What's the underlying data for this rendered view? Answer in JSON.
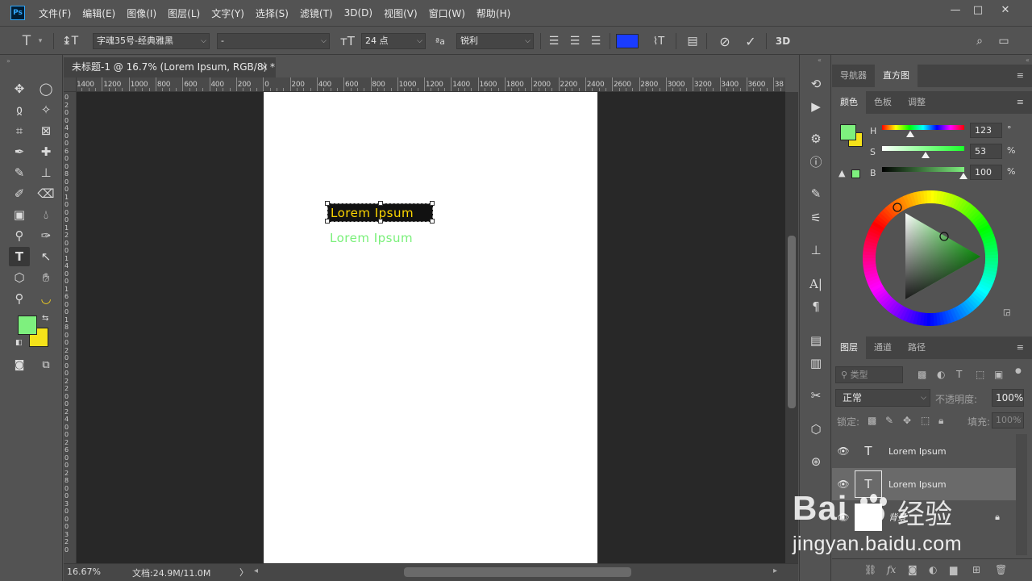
{
  "app": {
    "logo": "Ps"
  },
  "menu": [
    "文件(F)",
    "编辑(E)",
    "图像(I)",
    "图层(L)",
    "文字(Y)",
    "选择(S)",
    "滤镜(T)",
    "3D(D)",
    "视图(V)",
    "窗口(W)",
    "帮助(H)"
  ],
  "window_controls": {
    "minimize": "—",
    "restore": "□",
    "close": "✕"
  },
  "options": {
    "font_family": "字魂35号-经典雅黑",
    "font_style": "-",
    "font_size": "24 点",
    "aa_label": "ªa",
    "antialias": "锐利",
    "text_color": "#1a3cff",
    "threed_label": "3D"
  },
  "document": {
    "tab_title": "未标题-1 @ 16.7% (Lorem Ipsum, RGB/8) *",
    "close_glyph": "×",
    "ruler_h": [
      "1400",
      "1200",
      "1000",
      "800",
      "600",
      "400",
      "200",
      "0",
      "200",
      "400",
      "600",
      "800",
      "1000",
      "1200",
      "1400",
      "1600",
      "1800",
      "2000",
      "2200",
      "2400",
      "2600",
      "2800",
      "3000",
      "3200",
      "3400",
      "3600",
      "38"
    ],
    "ruler_v": [
      "0",
      "2",
      "0",
      "0",
      "4",
      "0",
      "0",
      "6",
      "0",
      "0",
      "8",
      "0",
      "0",
      "1",
      "0",
      "0",
      "0",
      "1",
      "2",
      "0",
      "0",
      "1",
      "4",
      "0",
      "0",
      "1",
      "6",
      "0",
      "0",
      "1",
      "8",
      "0",
      "0",
      "2",
      "0",
      "0",
      "0",
      "2",
      "2",
      "0",
      "0",
      "2",
      "4",
      "0",
      "0",
      "2",
      "6",
      "0",
      "0",
      "2",
      "8",
      "0",
      "0",
      "3",
      "0",
      "0",
      "0",
      "3",
      "2",
      "0"
    ]
  },
  "canvas": {
    "text_selected": "Lorem Ipsum",
    "text_green": "Lorem Ipsum",
    "text_selected_color": "#ffd700",
    "text_green_color": "#7af07a"
  },
  "status": {
    "zoom": "16.67%",
    "doc_info": "文档:24.9M/11.0M",
    "arrow": "〉"
  },
  "colors": {
    "foreground": "#7ef07e",
    "background": "#f5e21a"
  },
  "right_panel": {
    "top_tabs": [
      "导航器",
      "直方图"
    ],
    "color_tabs": [
      "颜色",
      "色板",
      "调整"
    ],
    "hsb": [
      {
        "label": "H",
        "value": "123",
        "unit": "°"
      },
      {
        "label": "S",
        "value": "53",
        "unit": "%"
      },
      {
        "label": "B",
        "value": "100",
        "unit": "%"
      }
    ],
    "layer_tabs": [
      "图层",
      "通道",
      "路径"
    ],
    "filter_placeholder": "类型",
    "blend_mode": "正常",
    "opacity_label": "不透明度:",
    "opacity_value": "100%",
    "lock_label": "锁定:",
    "fill_label": "填充:",
    "fill_value": "100%",
    "layers": [
      {
        "name": "Lorem Ipsum",
        "type_glyph": "T"
      },
      {
        "name": "Lorem Ipsum",
        "type_glyph": "T"
      },
      {
        "name": "背景",
        "type_glyph": ""
      }
    ]
  },
  "watermark": {
    "brand": "Bai",
    "brand2": "经验",
    "url": "jingyan.baidu.com"
  }
}
